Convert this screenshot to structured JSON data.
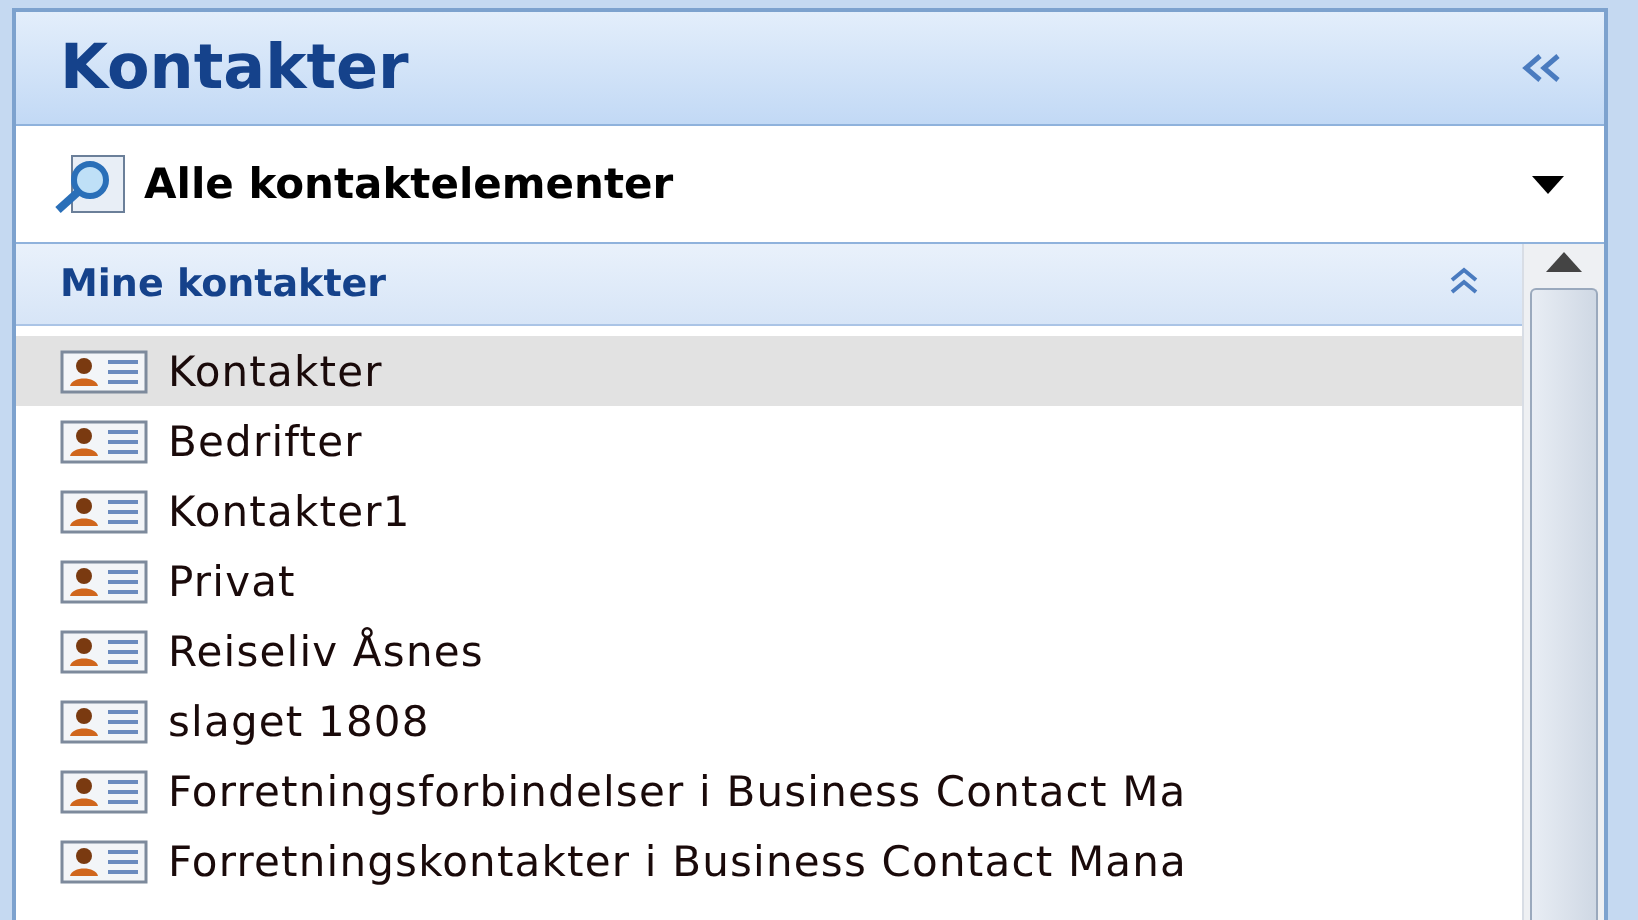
{
  "pane": {
    "title": "Kontakter"
  },
  "view_selector": {
    "value": "Alle kontaktelementer"
  },
  "section": {
    "title": "Mine kontakter",
    "expanded": true
  },
  "folders": [
    {
      "label": "Kontakter",
      "selected": true
    },
    {
      "label": "Bedrifter",
      "selected": false
    },
    {
      "label": "Kontakter1",
      "selected": false
    },
    {
      "label": "Privat",
      "selected": false
    },
    {
      "label": "Reiseliv Åsnes",
      "selected": false
    },
    {
      "label": "slaget 1808",
      "selected": false
    },
    {
      "label": "Forretningsforbindelser i Business Contact Ma",
      "selected": false
    },
    {
      "label": "Forretningskontakter i Business Contact Mana",
      "selected": false
    }
  ]
}
